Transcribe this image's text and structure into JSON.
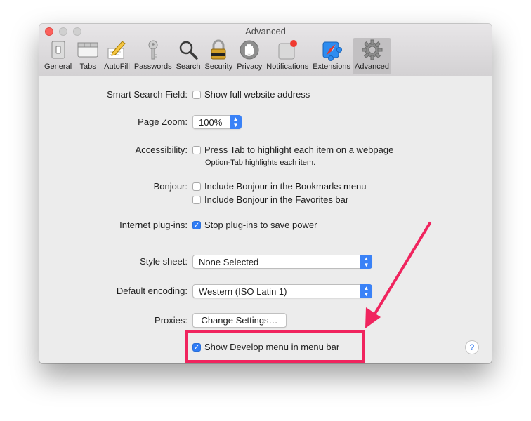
{
  "window": {
    "title": "Advanced"
  },
  "toolbar": {
    "items": [
      {
        "label": "General",
        "icon": "general-icon"
      },
      {
        "label": "Tabs",
        "icon": "tabs-icon"
      },
      {
        "label": "AutoFill",
        "icon": "autofill-icon"
      },
      {
        "label": "Passwords",
        "icon": "key-icon"
      },
      {
        "label": "Search",
        "icon": "search-icon"
      },
      {
        "label": "Security",
        "icon": "lock-icon"
      },
      {
        "label": "Privacy",
        "icon": "hand-icon"
      },
      {
        "label": "Notifications",
        "icon": "notifications-icon"
      },
      {
        "label": "Extensions",
        "icon": "puzzle-icon"
      },
      {
        "label": "Advanced",
        "icon": "gear-icon"
      }
    ],
    "active": "Advanced"
  },
  "settings": {
    "smart_search": {
      "label": "Smart Search Field:",
      "option": "Show full website address",
      "checked": false
    },
    "page_zoom": {
      "label": "Page Zoom:",
      "value": "100%"
    },
    "accessibility": {
      "label": "Accessibility:",
      "option": "Press Tab to highlight each item on a webpage",
      "note": "Option-Tab highlights each item.",
      "checked": false
    },
    "bonjour": {
      "label": "Bonjour:",
      "option1": "Include Bonjour in the Bookmarks menu",
      "option2": "Include Bonjour in the Favorites bar"
    },
    "plugins": {
      "label": "Internet plug-ins:",
      "option": "Stop plug-ins to save power",
      "checked": true
    },
    "style_sheet": {
      "label": "Style sheet:",
      "value": "None Selected"
    },
    "encoding": {
      "label": "Default encoding:",
      "value": "Western (ISO Latin 1)"
    },
    "proxies": {
      "label": "Proxies:",
      "button": "Change Settings…"
    },
    "develop": {
      "option": "Show Develop menu in menu bar",
      "checked": true
    }
  },
  "help": {
    "label": "?"
  },
  "colors": {
    "annotation": "#f0245e",
    "checkbox_accent": "#2f7cf6"
  }
}
